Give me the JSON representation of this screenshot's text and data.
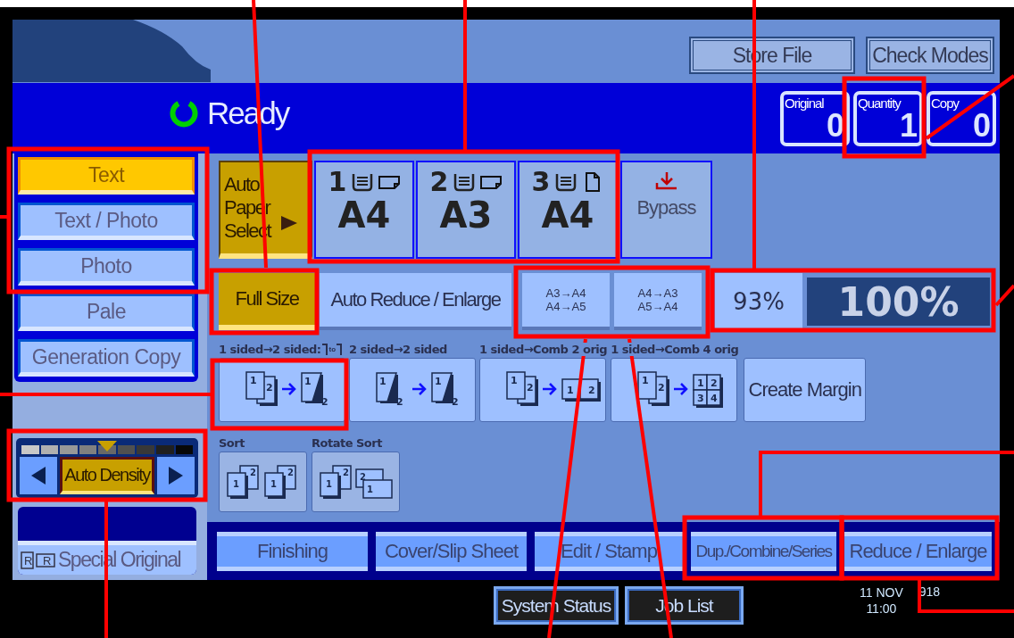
{
  "header": {
    "buttons": [
      {
        "label": "Store File"
      },
      {
        "label": "Check Modes"
      }
    ]
  },
  "status": {
    "text": "Ready"
  },
  "counters": [
    {
      "label": "Original",
      "value": "0"
    },
    {
      "label": "Quantity",
      "value": "1"
    },
    {
      "label": "Copy",
      "value": "0"
    }
  ],
  "original_types": [
    {
      "label": "Text",
      "selected": true
    },
    {
      "label": "Text / Photo",
      "selected": false
    },
    {
      "label": "Photo",
      "selected": false
    },
    {
      "label": "Pale",
      "selected": false
    },
    {
      "label": "Generation Copy",
      "selected": false
    }
  ],
  "density": {
    "label": "Auto Density",
    "selected": true,
    "level": 0.5
  },
  "special_original": {
    "label": "Special Original",
    "marks": [
      "R",
      "R"
    ]
  },
  "paper_select": {
    "label": "Auto Paper Select",
    "selected": true
  },
  "trays": [
    {
      "number": "1",
      "size": "A4",
      "kind": "landscape"
    },
    {
      "number": "2",
      "size": "A3",
      "kind": "landscape"
    },
    {
      "number": "3",
      "size": "A4",
      "kind": "portrait"
    }
  ],
  "bypass": {
    "label": "Bypass"
  },
  "ratios": [
    {
      "kind": "text",
      "label": "Full Size",
      "selected": true
    },
    {
      "kind": "text",
      "label": "Auto Reduce / Enlarge",
      "selected": false
    },
    {
      "kind": "pair",
      "lines": [
        "A3→A4",
        "A4→A5"
      ],
      "selected": false
    },
    {
      "kind": "pair",
      "lines": [
        "A4→A3",
        "A5→A4"
      ],
      "selected": false
    }
  ],
  "ratio_preset": "93%",
  "ratio_display": "100%",
  "duplex": [
    {
      "caption": "1 sided→2 sided:",
      "binding_text": "to",
      "from": {
        "kind": "stack",
        "pages": [
          "1",
          "2"
        ]
      },
      "to": {
        "kind": "flip",
        "pages": [
          "1",
          "2"
        ]
      }
    },
    {
      "caption": "2 sided→2 sided",
      "from": {
        "kind": "flip",
        "pages": [
          "1",
          "2"
        ]
      },
      "to": {
        "kind": "flip",
        "pages": [
          "1",
          "2"
        ]
      }
    },
    {
      "caption": "1 sided→Comb 2 orig",
      "from": {
        "kind": "stack",
        "pages": [
          "1",
          "2"
        ]
      },
      "to": {
        "kind": "pair",
        "pages": [
          "1",
          "2"
        ]
      }
    },
    {
      "caption": "1 sided→Comb 4 orig",
      "from": {
        "kind": "stack",
        "pages": [
          "1",
          "2"
        ]
      },
      "to": {
        "kind": "grid",
        "pages": [
          "1",
          "2",
          "3",
          "4"
        ]
      }
    }
  ],
  "margin_button": {
    "label": "Create Margin"
  },
  "sort": [
    {
      "caption": "Sort",
      "kind": "sort",
      "pages": [
        "1",
        "2",
        "1",
        "2"
      ]
    },
    {
      "caption": "Rotate Sort",
      "kind": "rotate",
      "pages": [
        "1",
        "2",
        "2",
        "1"
      ]
    }
  ],
  "tabs": [
    {
      "label": "Finishing"
    },
    {
      "label": "Cover/Slip Sheet"
    },
    {
      "label": "Edit / Stamp"
    },
    {
      "label": "Dup./Combine/Series"
    },
    {
      "label": "Reduce / Enlarge"
    }
  ],
  "footer": {
    "buttons": [
      {
        "label": "System Status"
      },
      {
        "label": "Job List"
      }
    ],
    "date": "11 NOV",
    "time": "11:00",
    "counter": "918"
  }
}
